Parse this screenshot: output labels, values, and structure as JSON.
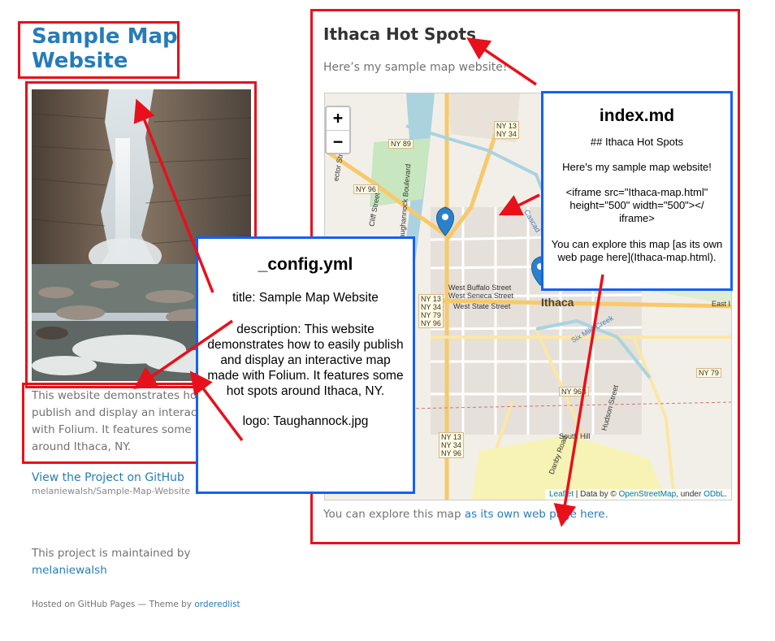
{
  "sidebar": {
    "site_title": "Sample Map Website",
    "description": "This website demonstrates how to easily publish and display an interactive map made with Folium. It features some hot spots around Ithaca, NY.",
    "github_link": "View the Project on GitHub",
    "github_repo": "melaniewalsh/Sample-Map-Website",
    "maintained_text": "This project is maintained by",
    "maintainer": "melaniewalsh",
    "footer_prefix": "Hosted on GitHub Pages — Theme by",
    "footer_theme": "orderedlist"
  },
  "main": {
    "heading": "Ithaca Hot Spots",
    "intro": "Here’s my sample map website!",
    "explore_prefix": "You can explore this map",
    "explore_link": "as its own web page here",
    "explore_suffix": "."
  },
  "map": {
    "zoom_in": "+",
    "zoom_out": "−",
    "attribution": {
      "leaflet": "Leaflet",
      "data_by": "| Data by ©",
      "osm": "OpenStreetMap",
      "under": ", under",
      "license": "ODbL",
      "end": "."
    },
    "labels": {
      "ny13_34_top": "NY 13\nNY 34",
      "ny89": "NY 89",
      "ny96_left": "NY 96",
      "ny13_34_79_96": "NY 13\nNY 34\nNY 79\nNY 96",
      "ny79": "NY 79",
      "ny96b": "NY 96B",
      "ny13_34_96_bottom": "NY 13\nNY 34\nNY 96",
      "ithaca": "Ithaca",
      "west_buffalo": "West Buffalo Street",
      "west_seneca": "West Seneca Street",
      "west_state": "West State Street",
      "six_mile_creek": "Six Mile Creek",
      "south_hill": "South Hill",
      "hudson_street": "Hudson Street",
      "danby_road": "Danby Road",
      "cliff_street": "Cliff Street",
      "taughannock": "Taughannock Boulevard",
      "east_i": "East I",
      "cascadilla": "Cascad",
      "lector": "ector Street"
    }
  },
  "callouts": {
    "config": {
      "title": "_config.yml",
      "title_line": "title: Sample Map Website",
      "desc_line": "description: This website demonstrates how to easily publish and display an interactive map made with Folium. It features some hot spots around Ithaca, NY.",
      "logo_line": "logo: Taughannock.jpg"
    },
    "index": {
      "title": "index.md",
      "heading_line": "## Ithaca Hot Spots",
      "intro_line": "Here's my sample map website!",
      "iframe_line": "<iframe src=\"Ithaca-map.html\" height=\"500\" width=\"500\"></ iframe>",
      "explore_line": "You can explore this map [as its own web page here](Ithaca-map.html)."
    }
  },
  "colors": {
    "annotation_red": "#e8101a",
    "callout_blue": "#1560f5",
    "link_blue": "#267CB9",
    "marker_blue": "#2A81CB"
  }
}
